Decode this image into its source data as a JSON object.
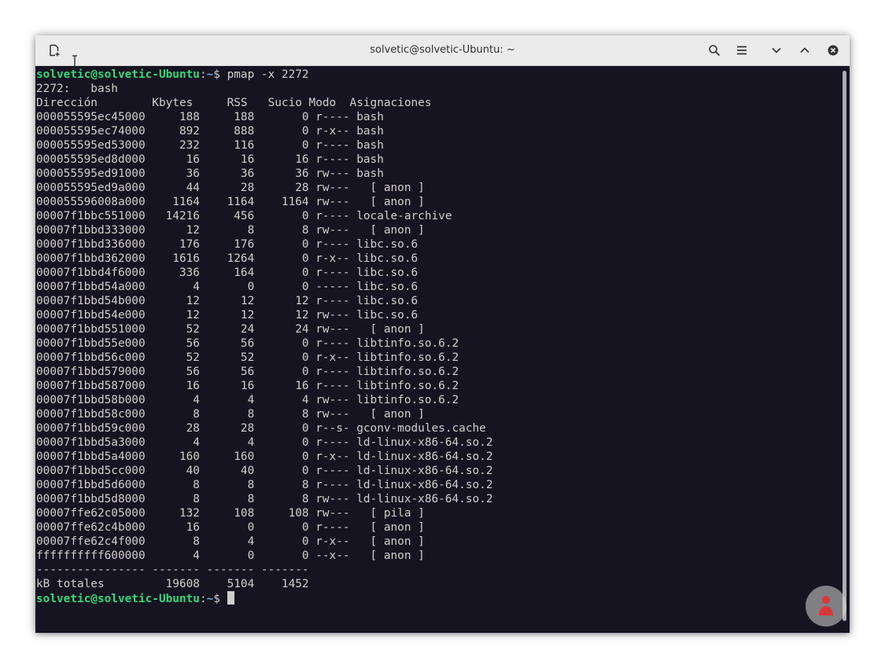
{
  "window": {
    "title": "solvetic@solvetic-Ubuntu: ~"
  },
  "icons": {
    "new_tab": "new-tab-icon",
    "search": "search-icon",
    "menu": "hamburger-menu-icon",
    "minimize": "chevron-down-icon",
    "maximize": "chevron-up-icon",
    "close": "close-icon"
  },
  "colors": {
    "terminal_bg": "#171421",
    "terminal_fg": "#d0cfcc",
    "prompt_user": "#33da7a",
    "prompt_path": "#6ea2e3",
    "titlebar_bg": "#ebebeb"
  },
  "prompt": {
    "user_host": "solvetic@solvetic-Ubuntu",
    "sep": ":",
    "path": "~",
    "symbol": "$ "
  },
  "command": "pmap -x 2272",
  "output": {
    "process": "2272:   bash",
    "header": "Dirección        Kbytes     RSS   Sucio Modo  Asignaciones",
    "rows": [
      "000055595ec45000     188     188       0 r---- bash",
      "000055595ec74000     892     888       0 r-x-- bash",
      "000055595ed53000     232     116       0 r---- bash",
      "000055595ed8d000      16      16      16 r---- bash",
      "000055595ed91000      36      36      36 rw--- bash",
      "000055595ed9a000      44      28      28 rw---   [ anon ]",
      "000055596008a000    1164    1164    1164 rw---   [ anon ]",
      "00007f1bbc551000   14216     456       0 r---- locale-archive",
      "00007f1bbd333000      12       8       8 rw---   [ anon ]",
      "00007f1bbd336000     176     176       0 r---- libc.so.6",
      "00007f1bbd362000    1616    1264       0 r-x-- libc.so.6",
      "00007f1bbd4f6000     336     164       0 r---- libc.so.6",
      "00007f1bbd54a000       4       0       0 ----- libc.so.6",
      "00007f1bbd54b000      12      12      12 r---- libc.so.6",
      "00007f1bbd54e000      12      12      12 rw--- libc.so.6",
      "00007f1bbd551000      52      24      24 rw---   [ anon ]",
      "00007f1bbd55e000      56      56       0 r---- libtinfo.so.6.2",
      "00007f1bbd56c000      52      52       0 r-x-- libtinfo.so.6.2",
      "00007f1bbd579000      56      56       0 r---- libtinfo.so.6.2",
      "00007f1bbd587000      16      16      16 r---- libtinfo.so.6.2",
      "00007f1bbd58b000       4       4       4 rw--- libtinfo.so.6.2",
      "00007f1bbd58c000       8       8       8 rw---   [ anon ]",
      "00007f1bbd59c000      28      28       0 r--s- gconv-modules.cache",
      "00007f1bbd5a3000       4       4       0 r---- ld-linux-x86-64.so.2",
      "00007f1bbd5a4000     160     160       0 r-x-- ld-linux-x86-64.so.2",
      "00007f1bbd5cc000      40      40       0 r---- ld-linux-x86-64.so.2",
      "00007f1bbd5d6000       8       8       8 r---- ld-linux-x86-64.so.2",
      "00007f1bbd5d8000       8       8       8 rw--- ld-linux-x86-64.so.2",
      "00007ffe62c05000     132     108     108 rw---   [ pila ]",
      "00007ffe62c4b000      16       0       0 r----   [ anon ]",
      "00007ffe62c4f000       8       4       0 r-x--   [ anon ]",
      "ffffffffff600000       4       0       0 --x--   [ anon ]"
    ],
    "separator": "---------------- ------- ------- -------",
    "totals": "kB totales         19608    5104    1452"
  }
}
